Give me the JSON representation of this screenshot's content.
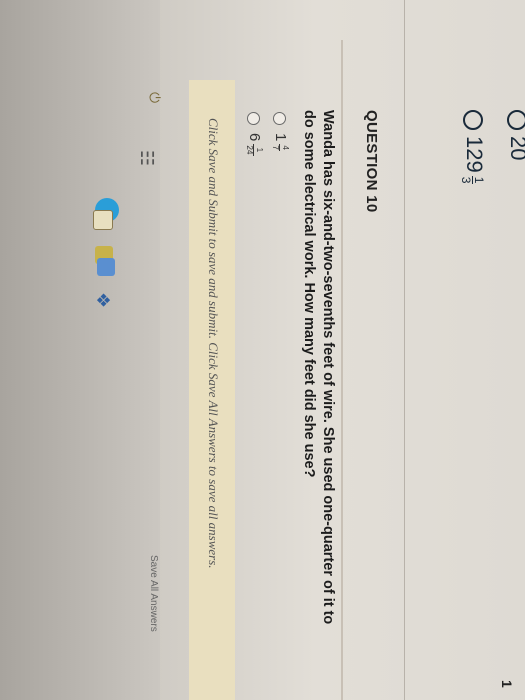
{
  "previous_question": {
    "option_top_label": "20",
    "option_bottom": {
      "whole": "129",
      "num": "1",
      "den": "3"
    }
  },
  "question": {
    "header": "QUESTION 10",
    "corner_number": "1",
    "text": "Wanda has six-and-two-sevenths feet of wire. She used one-quarter of it to do some electrical work. How many feet did she use?",
    "options": [
      {
        "whole": "1",
        "num": "4",
        "den": "7"
      },
      {
        "whole": "6",
        "num": "1",
        "den": "24"
      }
    ]
  },
  "footer": {
    "instructions": "Click Save and Submit to save and submit. Click Save All Answers to save all answers.",
    "save_all_label": "Save All Answers"
  },
  "taskbar": {
    "icons": [
      "edge-icon",
      "store-icon",
      "folder-icon",
      "app-icon",
      "dropbox-icon",
      "task-view-icon",
      "power-icon"
    ]
  },
  "colors": {
    "submit_bar": "#e9dfbf",
    "text": "#1c1c1c",
    "edge": "#2a9ed8"
  }
}
